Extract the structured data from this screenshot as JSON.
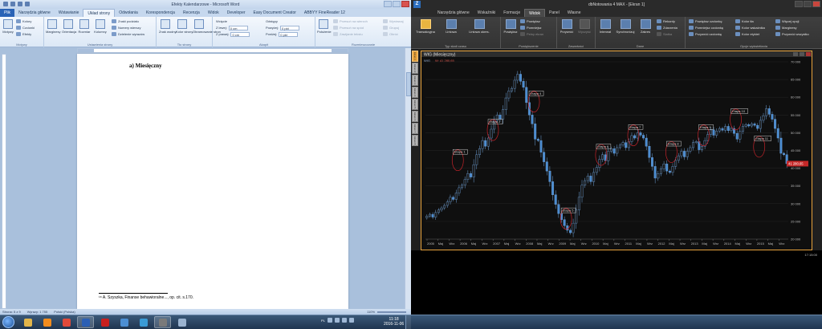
{
  "word": {
    "title": "Efekty Kalendarzowe - Microsoft Word",
    "tabs": [
      "Plik",
      "Narzędzia główne",
      "Wstawianie",
      "Układ strony",
      "Odwołania",
      "Korespondencja",
      "Recenzja",
      "Widok",
      "Developer",
      "Easy Document Creator",
      "ABBYY FineReader 12"
    ],
    "ribbon": {
      "motywy": {
        "label": "Motywy",
        "big": "Motywy",
        "kolory": "Kolory",
        "czcionki": "Czcionki",
        "efekty": "Efekty"
      },
      "ustawienia": {
        "label": "Ustawienia strony",
        "marginesy": "Marginesy",
        "orientacja": "Orientacja",
        "rozmiar": "Rozmiar",
        "kolumny": "Kolumny",
        "znaki_podzialu": "Znaki podziału",
        "numery_wierszy": "Numery wierszy",
        "dzielenie": "Dzielenie wyrazów"
      },
      "tlo": {
        "label": "Tło strony",
        "znak_wodny": "Znak wodny",
        "kolor_strony": "Kolor strony",
        "obramowanie": "Obramowanie stron"
      },
      "akapit": {
        "label": "Akapit",
        "wcięcie": "Wcięcie",
        "z_lewej": "Z lewej:",
        "z_prawej": "Z prawej:",
        "z_lewej_val": "0 cm",
        "z_prawej_val": "0 cm",
        "odstepy": "Odstępy",
        "powyzej": "Powyżej:",
        "ponizej": "Poniżej:",
        "powyzej_val": "0 pkt",
        "ponizej_val": "0 pkt"
      },
      "rozmieszczanie": {
        "label": "Rozmieszczanie",
        "polozenie": "Położenie",
        "przesun_wierzch": "Przesuń na wierzch",
        "przesun_spod": "Przesuń na spód",
        "zawijanie": "Zawijanie tekstu",
        "wyrownaj": "Wyrównaj",
        "grupuj": "Grupuj",
        "obroc": "Obróć"
      }
    },
    "document": {
      "heading": "a)    Miesięczny",
      "footnote": "¹⁸ A. Szyszka, Finanse behawioralne..., op. cit. s.170."
    },
    "status": {
      "page": "Strona: 5 z 9",
      "words": "Wyrazy: 1 755",
      "lang": "Polski (Polska)",
      "zoom": "110%"
    }
  },
  "stock": {
    "title": "dbNotowania 4 MAX - [Ekran 1]",
    "tabs": [
      "Narzędzia główne",
      "Wskaźniki",
      "Formacje",
      "Widok",
      "Panel",
      "Własne"
    ],
    "active_tab": "Widok",
    "ribbon": {
      "typ_label": "Typ skali czasu",
      "transakcyjna": "Transakcyjna",
      "liniowa": "Liniowa",
      "liniowa_okr": "Liniowa okres.",
      "powiekszenie_label": "Powiększenie",
      "powieksz_big": "Powiększ",
      "powieksz": "Powiększ",
      "pomniejsz": "Pomniejsz",
      "pelny_ekran": "Pełny ekran",
      "zawartosci_label": "Zawartości",
      "przywroc": "Przywróć",
      "wyczysc": "Wyczyść",
      "dane_label": "Dane",
      "interwal": "Interwał",
      "synchronizuj": "Synchronizuj",
      "zakres": "Zakres",
      "rekordy": "Rekordy",
      "zdarzenia": "Zdarzenia",
      "siatka": "Siatka",
      "opcje_label": "Opcje wyświetlania",
      "powieksz_czcionke": "Powiększ czcionkę",
      "pomniejsz_czcionke": "Pomniejsz czcionkę",
      "przywroc_czcionke": "Przywróć czcionkę",
      "kolor_tla": "Kolor tła",
      "kolor_wskaznika": "Kolor wskaźnika",
      "kolor_etykiet": "Kolor etykiet",
      "wiecej_opcji": "Więcej opcji",
      "marginesy": "Marginesy",
      "przywroc_wszystko": "Przywróć wszystko"
    },
    "side_tabs": [
      "Ekran 1",
      "Ekran 2",
      "Ekran 3",
      "Ekran 4",
      "Ekran 5",
      "Ekran 6",
      "Ekran 7",
      "Ekran 8"
    ],
    "chart_title": "WIG (Miesięczny)",
    "legend_name": "WIG",
    "legend_value": "W: 41 280,65",
    "price_label": "41 280,65",
    "clock": "17:15:00"
  },
  "chart_data": {
    "type": "candlestick",
    "title": "WIG (Miesięczny)",
    "ylim": [
      20000,
      70000
    ],
    "y_ticks": [
      "20 000",
      "25 000",
      "30 000",
      "35 000",
      "40 000",
      "45 000",
      "50 000",
      "55 000",
      "60 000",
      "65 000",
      "70 000"
    ],
    "x_ticks": [
      "2005",
      "Maj",
      "Wrz",
      "2006",
      "Maj",
      "Wrz",
      "2007",
      "Maj",
      "Wrz",
      "2008",
      "Maj",
      "Wrz",
      "2009",
      "Maj",
      "Wrz",
      "2010",
      "Maj",
      "Wrz",
      "2011",
      "Maj",
      "Wrz",
      "2012",
      "Maj",
      "Wrz",
      "2013",
      "Maj",
      "Wrz",
      "2014",
      "Maj",
      "Wrz",
      "2015",
      "Maj",
      "Wrz"
    ],
    "closes": [
      26500,
      27000,
      26200,
      27500,
      28200,
      28800,
      29500,
      30500,
      31800,
      31200,
      33000,
      34500,
      35200,
      36800,
      38500,
      37500,
      41000,
      43800,
      45500,
      47800,
      46200,
      48500,
      51000,
      53500,
      55000,
      53800,
      56500,
      59800,
      61800,
      62500,
      64800,
      66500,
      64500,
      62800,
      58500,
      55000,
      52500,
      48200,
      47800,
      44500,
      41800,
      39200,
      36200,
      32500,
      29800,
      27200,
      25500,
      23800,
      22500,
      21800,
      24500,
      28200,
      31800,
      35200,
      36500,
      37800,
      36200,
      38800,
      40200,
      42500,
      43800,
      42100,
      44800,
      45500,
      44200,
      45800,
      46500,
      47200,
      45800,
      47500,
      49200,
      48500,
      50000,
      49300,
      48500,
      46200,
      43000,
      40500,
      37200,
      38500,
      39800,
      41200,
      39200,
      38800,
      40500,
      42200,
      43500,
      44800,
      43200,
      44800,
      45800,
      47200,
      47500,
      45200,
      46200,
      47800,
      49500,
      50800,
      49300,
      50500,
      51200,
      50700,
      51800,
      50600,
      51200,
      49800,
      48200,
      50400,
      51800,
      52300,
      51900,
      52500,
      52100,
      51200,
      53500,
      54800,
      56800,
      55200,
      53800,
      51200,
      48500,
      44200,
      43800,
      41280
    ],
    "labels": [
      {
        "text": "Etapa 1",
        "i": 10,
        "y": 44500
      },
      {
        "text": "Etapa 2",
        "i": 22,
        "y": 53000
      },
      {
        "text": "Etapa 4",
        "i": 36,
        "y": 61000
      },
      {
        "text": "Etapa 5",
        "i": 47,
        "y": 28000
      },
      {
        "text": "Etapa 6",
        "i": 59,
        "y": 46000
      },
      {
        "text": "Etapa 7",
        "i": 70,
        "y": 51500
      },
      {
        "text": "Etapa 8",
        "i": 83,
        "y": 46800
      },
      {
        "text": "Etapa 9",
        "i": 94,
        "y": 51500
      },
      {
        "text": "Etapa 10",
        "i": 105,
        "y": 56000
      },
      {
        "text": "Etapa 11",
        "i": 113,
        "y": 48300
      }
    ]
  },
  "taskbar": {
    "lang": "PL",
    "time": "11:18",
    "date": "2016-11-06",
    "apps": [
      {
        "name": "explorer",
        "color": "#e2b54a",
        "on": false
      },
      {
        "name": "media",
        "color": "#f28c1e",
        "on": false
      },
      {
        "name": "chrome",
        "color": "#e04a3a",
        "on": false
      },
      {
        "name": "word",
        "color": "#2b5fb4",
        "on": true
      },
      {
        "name": "acrobat",
        "color": "#c8201f",
        "on": false
      },
      {
        "name": "windows",
        "color": "#4c8fd4",
        "on": false
      },
      {
        "name": "db",
        "color": "#3a9bd6",
        "on": false
      },
      {
        "name": "stock",
        "color": "#7a7a7a",
        "on": true
      },
      {
        "name": "sheet",
        "color": "#9ab3d0",
        "on": false
      }
    ]
  },
  "colors": {
    "candle_up": "#1c1c1c",
    "candle_down": "#4a8cd1",
    "label_border": "#cfcfcf",
    "circle": "#c3232a",
    "frame": "#e8a33d"
  }
}
